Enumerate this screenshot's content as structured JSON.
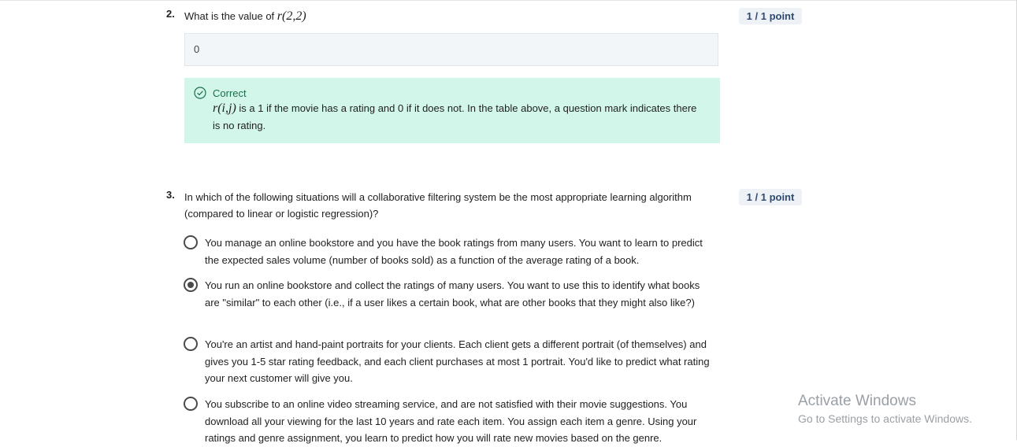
{
  "questions": [
    {
      "number": "2.",
      "text_prefix": "What is the value of ",
      "math": "r(2,2)",
      "points": "1 / 1 point",
      "answer_value": "0",
      "feedback": {
        "status": "Correct",
        "math": "r(i,j)",
        "text": " is a 1 if the movie has a rating and 0 if it does not. In the table above, a question mark indicates there is no rating."
      }
    },
    {
      "number": "3.",
      "text": "In which of the following situations will a collaborative filtering system be the most appropriate learning algorithm (compared to linear or logistic regression)?",
      "points": "1 / 1 point",
      "options": [
        {
          "text": "You manage an online bookstore and you have the book ratings from many users. You want to learn to predict the expected sales volume (number of books sold) as a function of the average rating of a book.",
          "selected": false
        },
        {
          "text": "You run an online bookstore and collect the ratings of many users. You want to use this to identify what books are \"similar\" to each other (i.e., if a user likes a certain book, what are other books that they might also like?)",
          "selected": true
        },
        {
          "text": "You're an artist and hand-paint portraits for your clients. Each client gets a different portrait (of themselves) and gives you 1-5 star rating feedback, and each client purchases at most 1 portrait. You'd like to predict what rating your next customer will give you.",
          "selected": false
        },
        {
          "text": "You subscribe to an online video streaming service, and are not satisfied with their movie suggestions. You download all your viewing for the last 10 years and rate each item. You assign each item a genre. Using your ratings and genre assignment, you learn to predict how you will rate new movies based on the genre.",
          "selected": false
        }
      ]
    }
  ],
  "watermark": {
    "title": "Activate Windows",
    "subtitle": "Go to Settings to activate Windows."
  }
}
